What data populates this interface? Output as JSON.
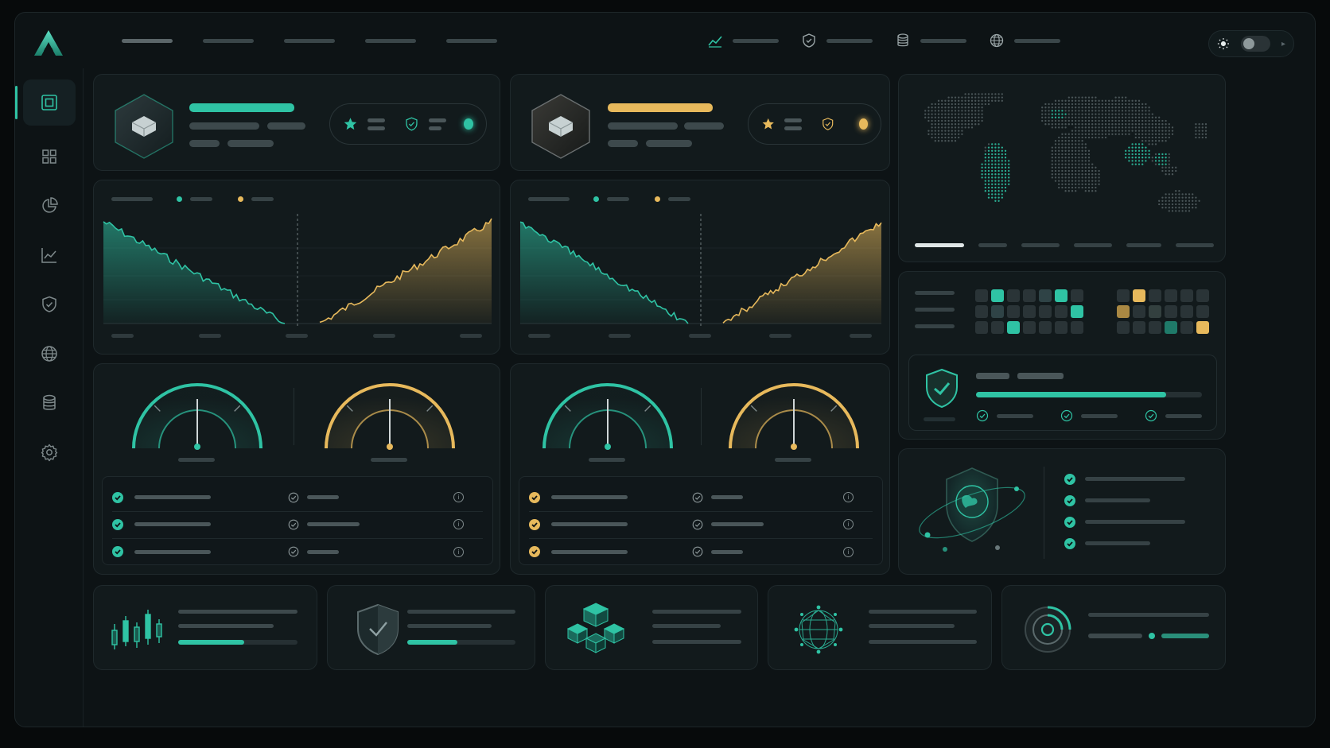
{
  "colors": {
    "accent": "#2fc3a4",
    "gold": "#e7b95c",
    "bg": "#0d1315",
    "card": "#121a1c"
  },
  "topbar": {
    "logo_icon": "logo-a-icon",
    "nav_links": [
      "",
      "",
      "",
      "",
      ""
    ],
    "icons": [
      "chart-line-icon",
      "shield-icon",
      "database-icon",
      "globe-icon"
    ],
    "theme_icon": "sun-icon"
  },
  "sidebar": {
    "items": [
      "dashboard-icon",
      "grid-icon",
      "pie-chart-icon",
      "line-chart-icon",
      "shield-icon",
      "globe-icon",
      "database-icon",
      "gear-icon"
    ],
    "active_index": 0
  },
  "asset_cards": [
    {
      "accent": "#2fc3a4",
      "icons": [
        "star-icon",
        "shield-icon"
      ]
    },
    {
      "accent": "#e7b95c",
      "icons": [
        "star-icon",
        "shield-icon"
      ]
    }
  ],
  "charts": [
    {
      "type": "area",
      "series": [
        {
          "color": "#2fc3a4",
          "trend": "down"
        },
        {
          "color": "#e7b95c",
          "trend": "up"
        }
      ]
    },
    {
      "type": "area",
      "series": [
        {
          "color": "#2fc3a4",
          "trend": "down"
        },
        {
          "color": "#e7b95c",
          "trend": "up"
        }
      ]
    }
  ],
  "gauges": [
    {
      "color": "#2fc3a4",
      "value": 0.5
    },
    {
      "color": "#e7b95c",
      "value": 0.5
    },
    {
      "color": "#2fc3a4",
      "value": 0.5
    },
    {
      "color": "#e7b95c",
      "value": 0.5
    }
  ],
  "checklists": [
    {
      "check_color": "#2fc3a4",
      "rows": 3
    },
    {
      "check_color": "#e7b95c",
      "rows": 3
    }
  ],
  "map_card": {
    "icon": "world-map-icon",
    "tabs": 6,
    "active_tab": 0
  },
  "heatmap_card": {
    "security_progress": 0.84
  },
  "globe_card": {
    "icon": "globe-shield-icon",
    "checks": 4
  },
  "bottom_cards": [
    {
      "icon": "candlestick-icon",
      "progress": 0.55
    },
    {
      "icon": "shield-icon",
      "progress": 0.46
    },
    {
      "icon": "cubes-icon"
    },
    {
      "icon": "network-globe-icon"
    },
    {
      "icon": "target-icon"
    }
  ]
}
